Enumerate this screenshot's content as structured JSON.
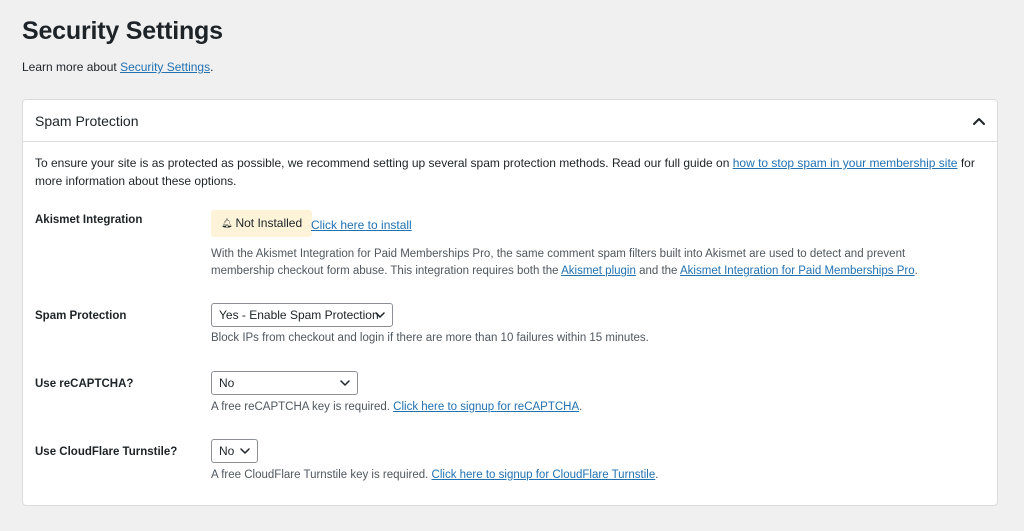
{
  "page": {
    "title": "Security Settings",
    "learn_more_prefix": "Learn more about ",
    "learn_more_link": "Security Settings",
    "learn_more_suffix": "."
  },
  "panel": {
    "title": "Spam Protection",
    "chevron_icon": "chevron-up-icon",
    "intro_prefix": "To ensure your site is as protected as possible, we recommend setting up several spam protection methods. Read our full guide on ",
    "intro_link": "how to stop spam in your membership site",
    "intro_suffix": " for more information about these options."
  },
  "akismet": {
    "label": "Akismet Integration",
    "badge_icon": "bell-icon",
    "badge_text": "Not Installed",
    "install_link": "Click here to install",
    "desc_prefix": "With the Akismet Integration for Paid Memberships Pro, the same comment spam filters built into Akismet are used to detect and prevent membership checkout form abuse. This integration requires both the ",
    "desc_link1": "Akismet plugin",
    "desc_middle": " and the ",
    "desc_link2": "Akismet Integration for Paid Memberships Pro",
    "desc_suffix": "."
  },
  "spam_protection": {
    "label": "Spam Protection",
    "selected": "Yes - Enable Spam Protection",
    "desc": "Block IPs from checkout and login if there are more than 10 failures within 15 minutes."
  },
  "recaptcha": {
    "label": "Use reCAPTCHA?",
    "selected": "No",
    "desc_prefix": "A free reCAPTCHA key is required. ",
    "desc_link": "Click here to signup for reCAPTCHA",
    "desc_suffix": "."
  },
  "turnstile": {
    "label": "Use CloudFlare Turnstile?",
    "selected": "No",
    "desc_prefix": "A free CloudFlare Turnstile key is required. ",
    "desc_link": "Click here to signup for CloudFlare Turnstile",
    "desc_suffix": "."
  },
  "colors": {
    "page_bg": "#f0f0f1",
    "link": "#2271b1",
    "badge_bg": "#fcf3d9",
    "border": "#dcdcde"
  }
}
